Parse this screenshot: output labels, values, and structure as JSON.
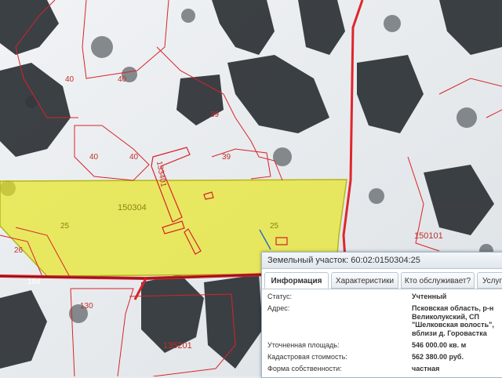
{
  "map": {
    "labels": [
      "40",
      "40",
      "40",
      "40",
      "39",
      "39",
      "133401",
      "150304",
      "25",
      "25",
      "26",
      "184",
      "130",
      "135201",
      "150101"
    ],
    "colors": {
      "boundary": "#d8232a",
      "selection_fill": "#e8e61c",
      "selection_stroke": "#b6b41a"
    }
  },
  "popup": {
    "title": "Земельный участок: 60:02:0150304:25",
    "tabs": [
      {
        "label": "Информация",
        "active": true
      },
      {
        "label": "Характеристики",
        "active": false
      },
      {
        "label": "Кто обслуживает?",
        "active": false
      },
      {
        "label": "Услуги",
        "active": false
      }
    ],
    "properties": [
      {
        "key": "Статус:",
        "value": "Учтенный"
      },
      {
        "key": "Адрес:",
        "value_lines": [
          "Псковская область, р-н",
          "Великолукский, СП",
          "\"Шелковская волость\",",
          "вблизи д. Горовастка"
        ]
      },
      {
        "key": "Уточненная площадь:",
        "value": "546 000.00 кв. м"
      },
      {
        "key": "Кадастровая стоимость:",
        "value": "562 380.00 руб."
      },
      {
        "key": "Форма собственности:",
        "value": "частная"
      }
    ]
  }
}
